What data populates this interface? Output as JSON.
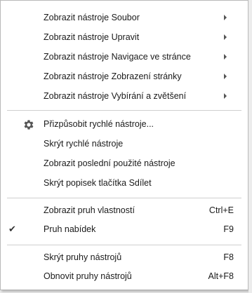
{
  "menu": {
    "toolbars_submenus": [
      {
        "label": "Zobrazit nástroje Soubor"
      },
      {
        "label": "Zobrazit nástroje Upravit"
      },
      {
        "label": "Zobrazit nástroje Navigace ve stránce"
      },
      {
        "label": "Zobrazit nástroje Zobrazení stránky"
      },
      {
        "label": "Zobrazit nástroje Vybírání a zvětšení"
      }
    ],
    "quick_tools": [
      {
        "label": "Přizpůsobit rychlé nástroje...",
        "icon": "gear-icon"
      },
      {
        "label": "Skrýt rychlé nástroje"
      },
      {
        "label": "Zobrazit poslední použité nástroje"
      },
      {
        "label": "Skrýt popisek tlačítka Sdílet"
      }
    ],
    "bars": [
      {
        "label": "Zobrazit pruh vlastností",
        "shortcut": "Ctrl+E",
        "checked": false
      },
      {
        "label": "Pruh nabídek",
        "shortcut": "F9",
        "checked": true,
        "check_glyph": "✔"
      }
    ],
    "toolbar_actions": [
      {
        "label": "Skrýt pruhy nástrojů",
        "shortcut": "F8"
      },
      {
        "label": "Obnovit pruhy nástrojů",
        "shortcut": "Alt+F8"
      }
    ]
  }
}
